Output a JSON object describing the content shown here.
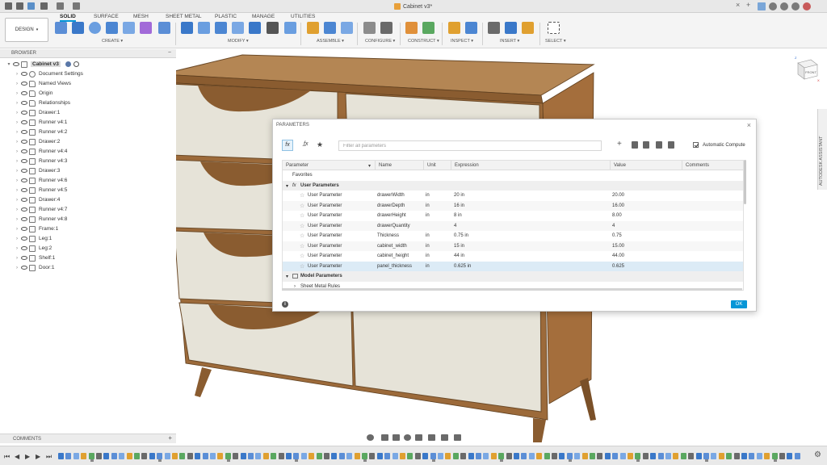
{
  "app": {
    "document_title": "Cabinet v3*",
    "workspace": "DESIGN",
    "tabs": [
      "SOLID",
      "SURFACE",
      "MESH",
      "SHEET METAL",
      "PLASTIC",
      "MANAGE",
      "UTILITIES"
    ],
    "active_tab": "SOLID",
    "groups": [
      "CREATE",
      "MODIFY",
      "ASSEMBLE",
      "CONFIGURE",
      "CONSTRUCT",
      "INSPECT",
      "INSERT",
      "SELECT"
    ]
  },
  "browser": {
    "title": "BROWSER",
    "root": "Cabinet v3",
    "nodes": [
      {
        "label": "Document Settings",
        "icon": "gear-icon"
      },
      {
        "label": "Named Views",
        "icon": "folder-icon"
      },
      {
        "label": "Origin",
        "icon": "folder-icon"
      },
      {
        "label": "Relationships",
        "icon": "folder-icon"
      },
      {
        "label": "Drawer:1",
        "icon": "component-icon"
      },
      {
        "label": "Runner v4:1",
        "icon": "component-icon"
      },
      {
        "label": "Runner v4:2",
        "icon": "component-icon"
      },
      {
        "label": "Drawer:2",
        "icon": "component-icon"
      },
      {
        "label": "Runner v4:4",
        "icon": "component-icon"
      },
      {
        "label": "Runner v4:3",
        "icon": "component-icon"
      },
      {
        "label": "Drawer:3",
        "icon": "component-icon"
      },
      {
        "label": "Runner v4:6",
        "icon": "component-icon"
      },
      {
        "label": "Runner v4:5",
        "icon": "component-icon"
      },
      {
        "label": "Drawer:4",
        "icon": "component-icon"
      },
      {
        "label": "Runner v4:7",
        "icon": "component-icon"
      },
      {
        "label": "Runner v4:8",
        "icon": "component-icon"
      },
      {
        "label": "Frame:1",
        "icon": "component-icon"
      },
      {
        "label": "Leg:1",
        "icon": "body-icon"
      },
      {
        "label": "Leg:2",
        "icon": "body-icon"
      },
      {
        "label": "Shelf:1",
        "icon": "body-icon"
      },
      {
        "label": "Door:1",
        "icon": "body-icon"
      }
    ]
  },
  "viewcube": {
    "face": "FRONT",
    "axis_z": "Z",
    "axis_x": "X"
  },
  "assistant": {
    "label": "AUTODESK ASSISTANT"
  },
  "parameters": {
    "title": "PARAMETERS",
    "search_placeholder": "Filter all parameters",
    "auto_compute_label": "Automatic Compute",
    "ok_label": "OK",
    "columns": [
      "Parameter",
      "Name",
      "Unit",
      "Expression",
      "Value",
      "Comments"
    ],
    "favorites_label": "Favorites",
    "user_section_label": "User Parameters",
    "rows": [
      {
        "param": "User Parameter",
        "name": "drawerWidth",
        "unit": "in",
        "expr": "20 in",
        "value": "20.00"
      },
      {
        "param": "User Parameter",
        "name": "drawerDepth",
        "unit": "in",
        "expr": "16 in",
        "value": "16.00"
      },
      {
        "param": "User Parameter",
        "name": "drawerHeight",
        "unit": "in",
        "expr": "8 in",
        "value": "8.00"
      },
      {
        "param": "User Parameter",
        "name": "drawerQuantity",
        "unit": "",
        "expr": "4",
        "value": "4"
      },
      {
        "param": "User Parameter",
        "name": "Thickness",
        "unit": "in",
        "expr": "0.75 in",
        "value": "0.75"
      },
      {
        "param": "User Parameter",
        "name": "cabinet_width",
        "unit": "in",
        "expr": "15 in",
        "value": "15.00"
      },
      {
        "param": "User Parameter",
        "name": "cabinet_height",
        "unit": "in",
        "expr": "44 in",
        "value": "44.00"
      },
      {
        "param": "User Parameter",
        "name": "panel_thickness",
        "unit": "in",
        "expr": "0.625 in",
        "value": "0.625"
      }
    ],
    "model_section_label": "Model Parameters",
    "sheet_metal_label": "Sheet Metal Rules"
  },
  "comments": {
    "label": "COMMENTS"
  },
  "colors": {
    "accent": "#0696d7",
    "wood": "#a9753f",
    "panel": "#e6e3d8"
  }
}
